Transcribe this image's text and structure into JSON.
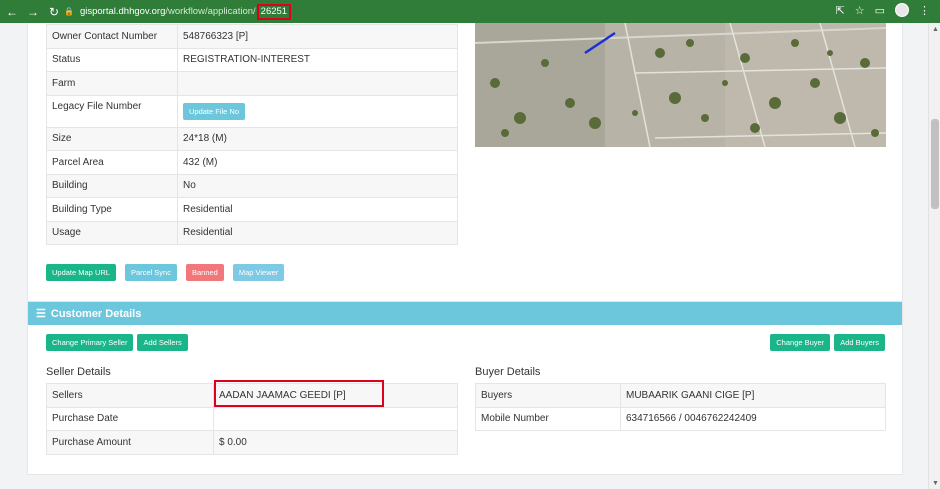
{
  "browser": {
    "url_host": "gisportal.dhhgov.org",
    "url_path": "/workflow/application/",
    "url_id": "26251"
  },
  "info_table": {
    "rows": [
      {
        "label": "Owner Contact Number",
        "value": "548766323 [P]"
      },
      {
        "label": "Status",
        "value": "REGISTRATION-INTEREST"
      },
      {
        "label": "Farm",
        "value": ""
      },
      {
        "label": "Legacy File Number",
        "value": "",
        "button": "Update File No"
      },
      {
        "label": "Size",
        "value": "24*18 (M)"
      },
      {
        "label": "Parcel Area",
        "value": "432 (M)"
      },
      {
        "label": "Building",
        "value": "No"
      },
      {
        "label": "Building Type",
        "value": "Residential"
      },
      {
        "label": "Usage",
        "value": "Residential"
      }
    ]
  },
  "actions": {
    "update_map_url": "Update Map URL",
    "parcel_sync": "Parcel Sync",
    "banned": "Banned",
    "map_viewer": "Map Viewer"
  },
  "customer": {
    "header": "Customer Details",
    "change_primary_seller": "Change Primary Seller",
    "add_sellers": "Add Sellers",
    "change_buyer": "Change Buyer",
    "add_buyers": "Add Buyers",
    "seller_title": "Seller Details",
    "buyer_title": "Buyer Details",
    "seller_rows": [
      {
        "label": "Sellers",
        "value": "AADAN JAAMAC GEEDI [P]"
      },
      {
        "label": "Purchase Date",
        "value": ""
      },
      {
        "label": "Purchase Amount",
        "value": "$ 0.00"
      }
    ],
    "buyer_rows": [
      {
        "label": "Buyers",
        "value": "MUBAARIK GAANI CIGE [P]"
      },
      {
        "label": "Mobile Number",
        "value": "634716566 / 0046762242409"
      }
    ]
  },
  "colors": {
    "browser_bar": "#2f7d38",
    "accent_cyan": "#6cc7dc",
    "green_button": "#1bb58a",
    "red_button": "#f2777a",
    "highlight": "#e0001b"
  }
}
